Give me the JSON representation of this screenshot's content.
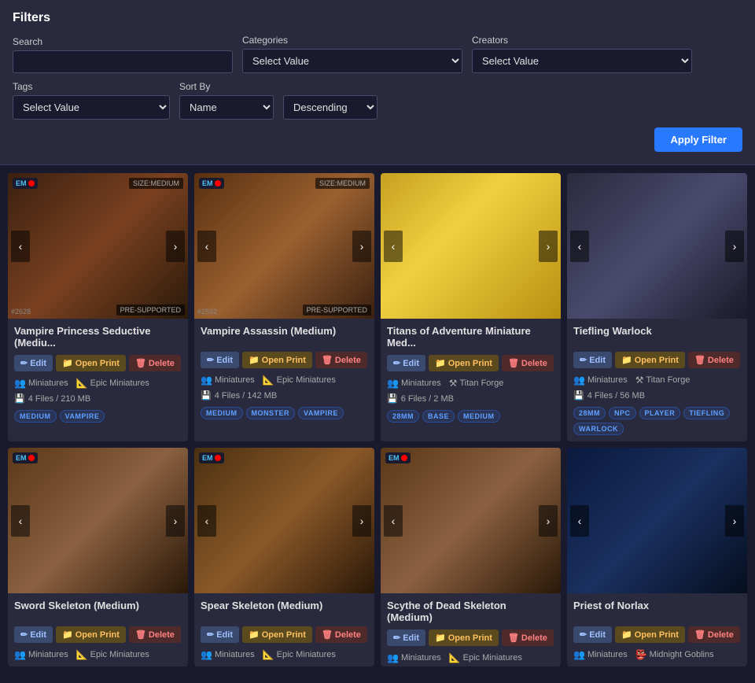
{
  "filters": {
    "title": "Filters",
    "search_label": "Search",
    "search_placeholder": "",
    "categories_label": "Categories",
    "categories_placeholder": "Select Value",
    "creators_label": "Creators",
    "creators_placeholder": "Select Value",
    "tags_label": "Tags",
    "tags_placeholder": "Select Value",
    "sortby_label": "Sort By",
    "sortby_value": "Name",
    "sortorder_value": "Descending",
    "apply_button": "Apply Filter"
  },
  "cards": [
    {
      "id": "vampire-princess",
      "title": "Vampire Princess Seductive (Mediu...",
      "badge_size": "SIZE:MEDIUM",
      "badge_presupported": "PRE-SUPPORTED",
      "badge_num": "#2628",
      "has_logo": true,
      "img_class": "img-vampire1",
      "creators": [
        "Miniatures",
        "Epic Miniatures"
      ],
      "files": "4 Files / 210 MB",
      "tags": [
        "MEDIUM",
        "VAMPIRE"
      ],
      "btn_edit": "Edit",
      "btn_print": "Open Print",
      "btn_delete": "Delete"
    },
    {
      "id": "vampire-assassin",
      "title": "Vampire Assassin (Medium)",
      "badge_size": "SIZE:MEDIUM",
      "badge_presupported": "PRE-SUPPORTED",
      "badge_num": "#2592",
      "has_logo": true,
      "img_class": "img-vampire2",
      "creators": [
        "Miniatures",
        "Epic Miniatures"
      ],
      "files": "4 Files / 142 MB",
      "tags": [
        "MEDIUM",
        "MONSTER",
        "VAMPIRE"
      ],
      "btn_edit": "Edit",
      "btn_print": "Open Print",
      "btn_delete": "Delete"
    },
    {
      "id": "titans-adventure",
      "title": "Titans of Adventure Miniature Med...",
      "badge_size": null,
      "badge_presupported": null,
      "badge_num": null,
      "has_logo": false,
      "img_class": "img-titans",
      "creators": [
        "Miniatures",
        "Titan Forge"
      ],
      "files": "6 Files / 2 MB",
      "tags": [
        "28MM",
        "BASE",
        "MEDIUM"
      ],
      "btn_edit": "Edit",
      "btn_print": "Open Print",
      "btn_delete": "Delete"
    },
    {
      "id": "tiefling-warlock",
      "title": "Tiefling Warlock",
      "badge_size": null,
      "badge_presupported": null,
      "badge_num": null,
      "has_logo": false,
      "img_class": "img-tiefling",
      "creators": [
        "Miniatures",
        "Titan Forge"
      ],
      "files": "4 Files / 56 MB",
      "tags": [
        "28MM",
        "NPC",
        "PLAYER",
        "TIEFLING",
        "WARLOCK"
      ],
      "btn_edit": "Edit",
      "btn_print": "Open Print",
      "btn_delete": "Delete"
    },
    {
      "id": "sword-skeleton",
      "title": "Sword Skeleton (Medium)",
      "badge_size": null,
      "badge_presupported": null,
      "badge_num": null,
      "has_logo": true,
      "img_class": "img-swordskeleton",
      "creators": [
        "Miniatures",
        "Epic Miniatures"
      ],
      "files": "",
      "tags": [],
      "btn_edit": "Edit",
      "btn_print": "Open Print",
      "btn_delete": "Delete"
    },
    {
      "id": "spear-skeleton",
      "title": "Spear Skeleton (Medium)",
      "badge_size": null,
      "badge_presupported": null,
      "badge_num": null,
      "has_logo": true,
      "img_class": "img-spear",
      "creators": [
        "Miniatures",
        "Epic Miniatures"
      ],
      "files": "",
      "tags": [],
      "btn_edit": "Edit",
      "btn_print": "Open Print",
      "btn_delete": "Delete"
    },
    {
      "id": "scythe-skeleton",
      "title": "Scythe of Dead Skeleton (Medium)",
      "badge_size": null,
      "badge_presupported": null,
      "badge_num": null,
      "has_logo": true,
      "img_class": "img-scythe",
      "creators": [
        "Miniatures",
        "Epic Miniatures"
      ],
      "files": "",
      "tags": [],
      "btn_edit": "Edit",
      "btn_print": "Open Print",
      "btn_delete": "Delete"
    },
    {
      "id": "priest-norlax",
      "title": "Priest of Norlax",
      "badge_size": null,
      "badge_presupported": null,
      "badge_num": null,
      "has_logo": false,
      "img_class": "img-priest",
      "creators": [
        "Miniatures",
        "Midnight Goblins"
      ],
      "files": "",
      "tags": [],
      "btn_edit": "Edit",
      "btn_print": "Open Print",
      "btn_delete": "Delete"
    }
  ],
  "icons": {
    "prev": "‹",
    "next": "›",
    "edit": "✏",
    "print": "📁",
    "delete": "🗑",
    "files": "💾",
    "miniatures": "👥",
    "creator": "📐"
  }
}
